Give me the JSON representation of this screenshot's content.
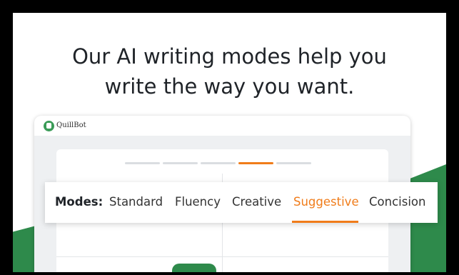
{
  "headline": {
    "line1": "Our AI writing modes help you",
    "line2": "write the way you want."
  },
  "app": {
    "brand": "QuillBot"
  },
  "modes": {
    "label": "Modes:",
    "items": [
      {
        "label": "Standard",
        "active": false
      },
      {
        "label": "Fluency",
        "active": false
      },
      {
        "label": "Creative",
        "active": false
      },
      {
        "label": "Suggestive",
        "active": true
      },
      {
        "label": "Concision",
        "active": false
      }
    ]
  },
  "colors": {
    "accent": "#f07c1a",
    "brand_green": "#2e8a4b"
  }
}
